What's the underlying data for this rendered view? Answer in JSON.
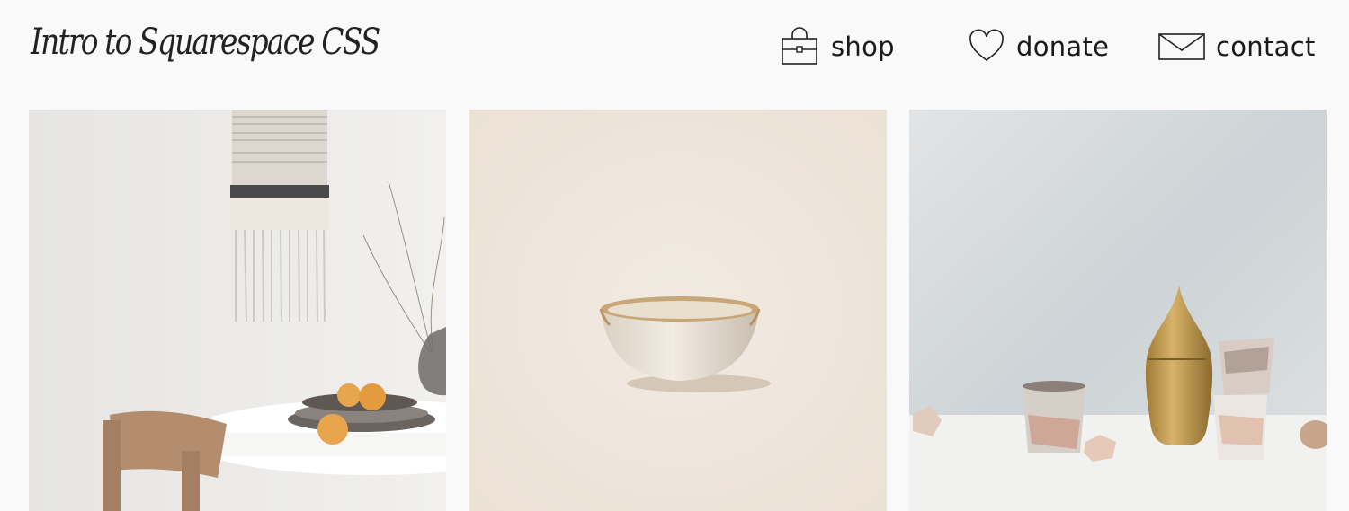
{
  "site": {
    "title": "Intro to Squarespace CSS"
  },
  "nav": {
    "items": [
      {
        "label": "shop",
        "icon": "shopping-bag-icon"
      },
      {
        "label": "donate",
        "icon": "heart-icon"
      },
      {
        "label": "contact",
        "icon": "envelope-icon"
      }
    ]
  },
  "gallery": {
    "images": [
      {
        "subject": "dining-table-with-wall-weaving"
      },
      {
        "subject": "ceramic-bowl"
      },
      {
        "subject": "ceramic-cups-and-brass-vessel"
      }
    ]
  }
}
